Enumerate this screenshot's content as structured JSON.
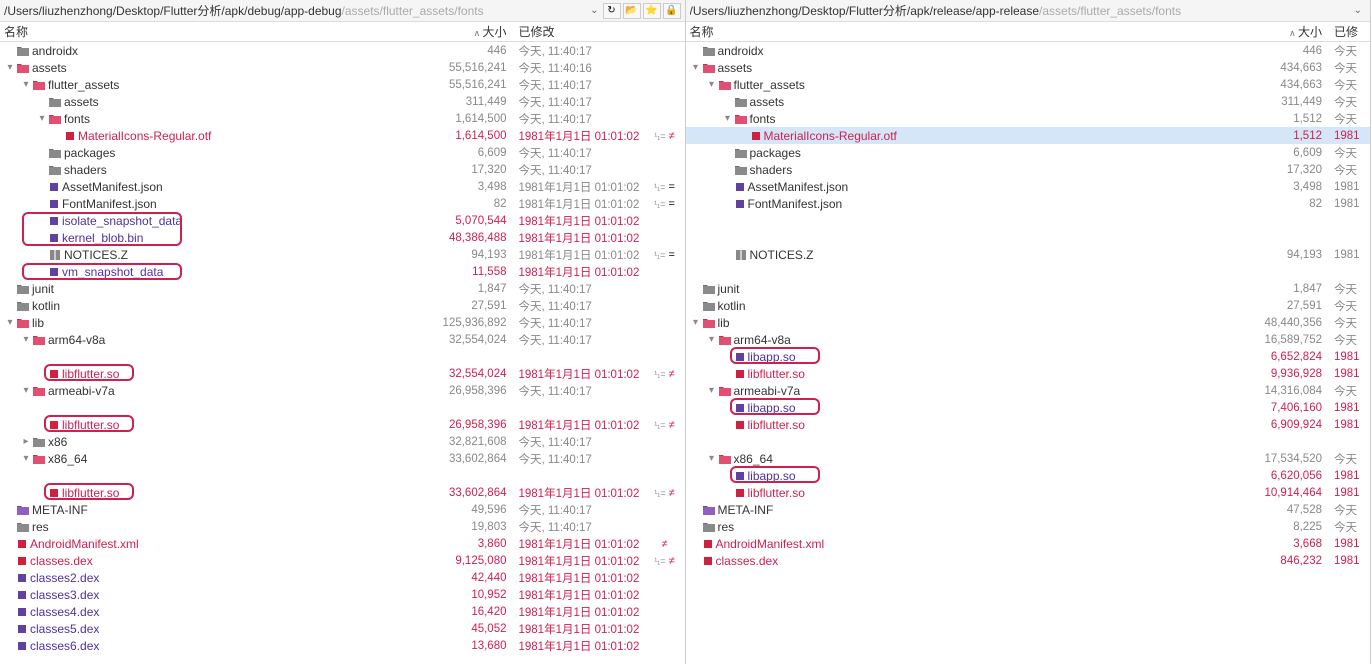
{
  "left": {
    "path_dark": "/Users/liuzhenzhong/Desktop/Flutter分析/apk/debug/app-debug",
    "path_grey": "/assets/flutter_assets/fonts",
    "headers": {
      "name": "名称",
      "size": "大小",
      "mod": "已修改"
    },
    "rows": [
      {
        "d": 0,
        "t": "fg",
        "n": "androidx",
        "s": "446",
        "dt": "今天, 11:40:17"
      },
      {
        "d": 0,
        "t": "fr",
        "tw": "▾",
        "n": "assets",
        "s": "55,516,241",
        "dt": "今天, 11:40:16"
      },
      {
        "d": 1,
        "t": "fr",
        "tw": "▾",
        "n": "flutter_assets",
        "s": "55,516,241",
        "dt": "今天, 11:40:17"
      },
      {
        "d": 2,
        "t": "fg",
        "n": "assets",
        "s": "311,449",
        "dt": "今天, 11:40:17"
      },
      {
        "d": 2,
        "t": "fr",
        "tw": "▾",
        "n": "fonts",
        "s": "1,614,500",
        "dt": "今天, 11:40:17"
      },
      {
        "d": 3,
        "t": "br",
        "n": "MaterialIcons-Regular.otf",
        "nc": "txt-red",
        "s": "1,614,500",
        "sc": "size-red",
        "dt": "1981年1月1日 01:01:02",
        "dtc": "date-red",
        "df": "≠",
        "dfc": "diff-red",
        "diffpre": "¹₁="
      },
      {
        "d": 2,
        "t": "fg",
        "n": "packages",
        "s": "6,609",
        "dt": "今天, 11:40:17"
      },
      {
        "d": 2,
        "t": "fg",
        "n": "shaders",
        "s": "17,320",
        "dt": "今天, 11:40:17"
      },
      {
        "d": 2,
        "t": "bp",
        "n": "AssetManifest.json",
        "s": "3,498",
        "dt": "1981年1月1日 01:01:02",
        "df": "=",
        "diffpre": "¹₁="
      },
      {
        "d": 2,
        "t": "bp",
        "n": "FontManifest.json",
        "s": "82",
        "dt": "1981年1月1日 01:01:02",
        "df": "=",
        "diffpre": "¹₁="
      },
      {
        "d": 2,
        "t": "bp",
        "n": "isolate_snapshot_data",
        "nc": "txt-purple",
        "s": "5,070,544",
        "sc": "size-red",
        "dt": "1981年1月1日 01:01:02",
        "dtc": "date-red",
        "hl": "row-isd"
      },
      {
        "d": 2,
        "t": "bp",
        "n": "kernel_blob.bin",
        "nc": "txt-purple",
        "s": "48,386,488",
        "sc": "size-red",
        "dt": "1981年1月1日 01:01:02",
        "dtc": "date-red"
      },
      {
        "d": 2,
        "t": "fg",
        "ic": "z",
        "n": "NOTICES.Z",
        "s": "94,193",
        "dt": "1981年1月1日 01:01:02",
        "df": "=",
        "diffpre": "¹₁="
      },
      {
        "d": 2,
        "t": "bp",
        "n": "vm_snapshot_data",
        "nc": "txt-purple",
        "s": "11,558",
        "sc": "size-red",
        "dt": "1981年1月1日 01:01:02",
        "dtc": "date-red",
        "hl": "row-vsd"
      },
      {
        "d": 0,
        "t": "fg",
        "n": "junit",
        "s": "1,847",
        "dt": "今天, 11:40:17"
      },
      {
        "d": 0,
        "t": "fg",
        "n": "kotlin",
        "s": "27,591",
        "dt": "今天, 11:40:17"
      },
      {
        "d": 0,
        "t": "fr",
        "tw": "▾",
        "n": "lib",
        "s": "125,936,892",
        "dt": "今天, 11:40:17"
      },
      {
        "d": 1,
        "t": "fr",
        "tw": "▾",
        "n": "arm64-v8a",
        "s": "32,554,024",
        "dt": "今天, 11:40:17"
      },
      {
        "d": 1,
        "t": "sp",
        "n": ""
      },
      {
        "d": 2,
        "t": "br",
        "n": "libflutter.so",
        "nc": "txt-red",
        "s": "32,554,024",
        "sc": "size-red",
        "dt": "1981年1月1日 01:01:02",
        "dtc": "date-red",
        "df": "≠",
        "dfc": "diff-red",
        "diffpre": "¹₁=",
        "box": 1
      },
      {
        "d": 1,
        "t": "fr",
        "tw": "▾",
        "n": "armeabi-v7a",
        "s": "26,958,396",
        "dt": "今天, 11:40:17"
      },
      {
        "d": 1,
        "t": "sp",
        "n": ""
      },
      {
        "d": 2,
        "t": "br",
        "n": "libflutter.so",
        "nc": "txt-red",
        "s": "26,958,396",
        "sc": "size-red",
        "dt": "1981年1月1日 01:01:02",
        "dtc": "date-red",
        "df": "≠",
        "dfc": "diff-red",
        "diffpre": "¹₁=",
        "box": 1
      },
      {
        "d": 1,
        "t": "fg",
        "tw": "▸",
        "n": "x86",
        "s": "32,821,608",
        "dt": "今天, 11:40:17"
      },
      {
        "d": 1,
        "t": "fr",
        "tw": "▾",
        "n": "x86_64",
        "s": "33,602,864",
        "dt": "今天, 11:40:17"
      },
      {
        "d": 1,
        "t": "sp",
        "n": ""
      },
      {
        "d": 2,
        "t": "br",
        "n": "libflutter.so",
        "nc": "txt-red",
        "s": "33,602,864",
        "sc": "size-red",
        "dt": "1981年1月1日 01:01:02",
        "dtc": "date-red",
        "df": "≠",
        "dfc": "diff-red",
        "diffpre": "¹₁=",
        "box": 1
      },
      {
        "d": 0,
        "t": "fpu",
        "n": "META-INF",
        "s": "49,596",
        "dt": "今天, 11:40:17"
      },
      {
        "d": 0,
        "t": "fg",
        "n": "res",
        "s": "19,803",
        "dt": "今天, 11:40:17"
      },
      {
        "d": 0,
        "t": "br",
        "n": "AndroidManifest.xml",
        "nc": "txt-red",
        "s": "3,860",
        "sc": "size-red",
        "dt": "1981年1月1日 01:01:02",
        "dtc": "date-red",
        "df": "≠",
        "dfc": "diff-red"
      },
      {
        "d": 0,
        "t": "br",
        "n": "classes.dex",
        "nc": "txt-red",
        "s": "9,125,080",
        "sc": "size-red",
        "dt": "1981年1月1日 01:01:02",
        "dtc": "date-red",
        "df": "≠",
        "dfc": "diff-red",
        "diffpre": "¹₁="
      },
      {
        "d": 0,
        "t": "bp",
        "n": "classes2.dex",
        "nc": "txt-purple",
        "s": "42,440",
        "sc": "size-red",
        "dt": "1981年1月1日 01:01:02",
        "dtc": "date-red"
      },
      {
        "d": 0,
        "t": "bp",
        "n": "classes3.dex",
        "nc": "txt-purple",
        "s": "10,952",
        "sc": "size-red",
        "dt": "1981年1月1日 01:01:02",
        "dtc": "date-red"
      },
      {
        "d": 0,
        "t": "bp",
        "n": "classes4.dex",
        "nc": "txt-purple",
        "s": "16,420",
        "sc": "size-red",
        "dt": "1981年1月1日 01:01:02",
        "dtc": "date-red"
      },
      {
        "d": 0,
        "t": "bp",
        "n": "classes5.dex",
        "nc": "txt-purple",
        "s": "45,052",
        "sc": "size-red",
        "dt": "1981年1月1日 01:01:02",
        "dtc": "date-red"
      },
      {
        "d": 0,
        "t": "bp",
        "n": "classes6.dex",
        "nc": "txt-purple",
        "s": "13,680",
        "sc": "size-red",
        "dt": "1981年1月1日 01:01:02",
        "dtc": "date-red"
      }
    ]
  },
  "right": {
    "path_dark": "/Users/liuzhenzhong/Desktop/Flutter分析/apk/release/app-release",
    "path_grey": "/assets/flutter_assets/fonts",
    "headers": {
      "name": "名称",
      "size": "大小",
      "mod": "已修"
    },
    "rows": [
      {
        "d": 0,
        "t": "fg",
        "n": "androidx",
        "s": "446",
        "dt": "今天"
      },
      {
        "d": 0,
        "t": "fr",
        "tw": "▾",
        "n": "assets",
        "s": "434,663",
        "dt": "今天"
      },
      {
        "d": 1,
        "t": "fr",
        "tw": "▾",
        "n": "flutter_assets",
        "s": "434,663",
        "dt": "今天"
      },
      {
        "d": 2,
        "t": "fg",
        "n": "assets",
        "s": "311,449",
        "dt": "今天"
      },
      {
        "d": 2,
        "t": "fr",
        "tw": "▾",
        "n": "fonts",
        "s": "1,512",
        "dt": "今天"
      },
      {
        "d": 3,
        "t": "br",
        "n": "MaterialIcons-Regular.otf",
        "nc": "txt-red",
        "s": "1,512",
        "sc": "size-red",
        "dt": "1981",
        "dtc": "date-red",
        "sel": 1
      },
      {
        "d": 2,
        "t": "fg",
        "n": "packages",
        "s": "6,609",
        "dt": "今天"
      },
      {
        "d": 2,
        "t": "fg",
        "n": "shaders",
        "s": "17,320",
        "dt": "今天"
      },
      {
        "d": 2,
        "t": "bp",
        "n": "AssetManifest.json",
        "s": "3,498",
        "dt": "1981"
      },
      {
        "d": 2,
        "t": "bp",
        "n": "FontManifest.json",
        "s": "82",
        "dt": "1981"
      },
      {
        "d": 2,
        "t": "sp",
        "n": ""
      },
      {
        "d": 2,
        "t": "sp",
        "n": ""
      },
      {
        "d": 2,
        "t": "fg",
        "ic": "z",
        "n": "NOTICES.Z",
        "s": "94,193",
        "dt": "1981"
      },
      {
        "d": 2,
        "t": "sp",
        "n": ""
      },
      {
        "d": 0,
        "t": "fg",
        "n": "junit",
        "s": "1,847",
        "dt": "今天"
      },
      {
        "d": 0,
        "t": "fg",
        "n": "kotlin",
        "s": "27,591",
        "dt": "今天"
      },
      {
        "d": 0,
        "t": "fr",
        "tw": "▾",
        "n": "lib",
        "s": "48,440,356",
        "dt": "今天"
      },
      {
        "d": 1,
        "t": "fr",
        "tw": "▾",
        "n": "arm64-v8a",
        "s": "16,589,752",
        "dt": "今天"
      },
      {
        "d": 2,
        "t": "bp",
        "n": "libapp.so",
        "nc": "txt-purple",
        "s": "6,652,824",
        "sc": "size-red",
        "dt": "1981",
        "dtc": "date-red",
        "box": 1
      },
      {
        "d": 2,
        "t": "br",
        "n": "libflutter.so",
        "nc": "txt-red",
        "s": "9,936,928",
        "sc": "size-red",
        "dt": "1981",
        "dtc": "date-red"
      },
      {
        "d": 1,
        "t": "fr",
        "tw": "▾",
        "n": "armeabi-v7a",
        "s": "14,316,084",
        "dt": "今天"
      },
      {
        "d": 2,
        "t": "bp",
        "n": "libapp.so",
        "nc": "txt-purple",
        "s": "7,406,160",
        "sc": "size-red",
        "dt": "1981",
        "dtc": "date-red",
        "box": 1
      },
      {
        "d": 2,
        "t": "br",
        "n": "libflutter.so",
        "nc": "txt-red",
        "s": "6,909,924",
        "sc": "size-red",
        "dt": "1981",
        "dtc": "date-red"
      },
      {
        "d": 1,
        "t": "sp",
        "n": ""
      },
      {
        "d": 1,
        "t": "fr",
        "tw": "▾",
        "n": "x86_64",
        "s": "17,534,520",
        "dt": "今天"
      },
      {
        "d": 2,
        "t": "bp",
        "n": "libapp.so",
        "nc": "txt-purple",
        "s": "6,620,056",
        "sc": "size-red",
        "dt": "1981",
        "dtc": "date-red",
        "box": 1
      },
      {
        "d": 2,
        "t": "br",
        "n": "libflutter.so",
        "nc": "txt-red",
        "s": "10,914,464",
        "sc": "size-red",
        "dt": "1981",
        "dtc": "date-red"
      },
      {
        "d": 0,
        "t": "fpu",
        "n": "META-INF",
        "s": "47,528",
        "dt": "今天"
      },
      {
        "d": 0,
        "t": "fg",
        "n": "res",
        "s": "8,225",
        "dt": "今天"
      },
      {
        "d": 0,
        "t": "br",
        "n": "AndroidManifest.xml",
        "nc": "txt-red",
        "s": "3,668",
        "sc": "size-red",
        "dt": "1981",
        "dtc": "date-red"
      },
      {
        "d": 0,
        "t": "br",
        "n": "classes.dex",
        "nc": "txt-red",
        "s": "846,232",
        "sc": "size-red",
        "dt": "1981",
        "dtc": "date-red"
      }
    ]
  },
  "toolbar": {
    "refresh": "↻",
    "open": "📂",
    "star": "⭐",
    "lock": "🔒"
  }
}
